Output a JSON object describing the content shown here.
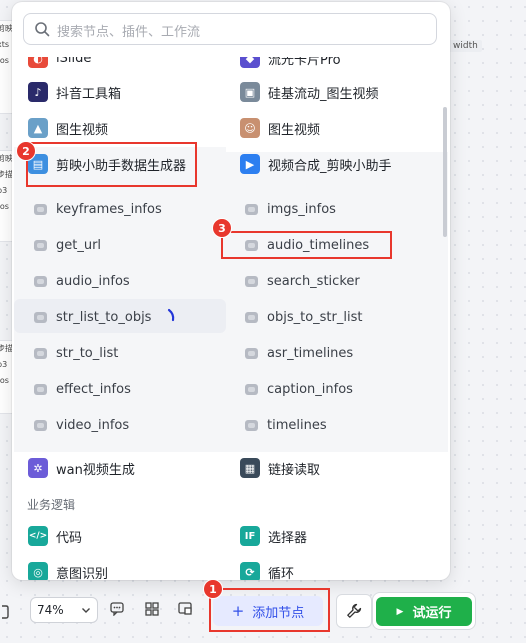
{
  "search": {
    "placeholder": "搜索节点、插件、工作流"
  },
  "plugins_top": [
    {
      "label": "iSlide",
      "icon": "islide-icon",
      "color": "#e84a3a"
    },
    {
      "label": "流光卡片Pro",
      "icon": "card-icon",
      "color": "#5a4fcf"
    },
    {
      "label": "抖音工具箱",
      "icon": "douyin-icon",
      "color": "#2a2a6a"
    },
    {
      "label": "硅基流动_图生视频",
      "icon": "silicon-flow-icon",
      "color": "#7a8a9a"
    },
    {
      "label": "图生视频",
      "icon": "image-video-icon",
      "color": "#6aa0c8"
    },
    {
      "label": "图生视频",
      "icon": "portrait-icon",
      "color": "#c89070"
    },
    {
      "label": "剪映小助手数据生成器",
      "icon": "jianying-data-icon",
      "color": "#3d8fe0"
    },
    {
      "label": "视频合成_剪映小助手",
      "icon": "video-compose-icon",
      "color": "#2d7ff0"
    }
  ],
  "tools": [
    "keyframes_infos",
    "imgs_infos",
    "get_url",
    "audio_timelines",
    "audio_infos",
    "search_sticker",
    "str_list_to_objs",
    "objs_to_str_list",
    "str_to_list",
    "asr_timelines",
    "effect_infos",
    "caption_infos",
    "video_infos",
    "timelines"
  ],
  "plugins_bottom": [
    {
      "label": "wan视频生成",
      "icon": "wan-icon",
      "color": "#6c5cd8"
    },
    {
      "label": "链接读取",
      "icon": "link-reader-icon",
      "color": "#3a4a5a"
    }
  ],
  "section_logic": {
    "title": "业务逻辑"
  },
  "logic_nodes": [
    {
      "label": "代码",
      "icon": "code-icon",
      "glyph": "</>",
      "color": "#18a89a"
    },
    {
      "label": "选择器",
      "icon": "if-icon",
      "glyph": "IF",
      "color": "#18a89a"
    },
    {
      "label": "意图识别",
      "icon": "intent-icon",
      "glyph": "◎",
      "color": "#18a89a"
    },
    {
      "label": "循环",
      "icon": "loop-icon",
      "glyph": "⟳",
      "color": "#18a89a"
    }
  ],
  "badges": [
    "1",
    "2",
    "3"
  ],
  "toolbar": {
    "zoom": "74%",
    "add_node": "添加节点",
    "run": "试运行"
  },
  "background": {
    "width_tag": "width",
    "node_lines": [
      "剪映",
      "xts",
      "fos",
      "",
      "剪映",
      "步描",
      "p3",
      "fos"
    ]
  },
  "colors": {
    "accent": "#3250e8",
    "run_green": "#1fb04a",
    "annotation_red": "#e8372d"
  }
}
